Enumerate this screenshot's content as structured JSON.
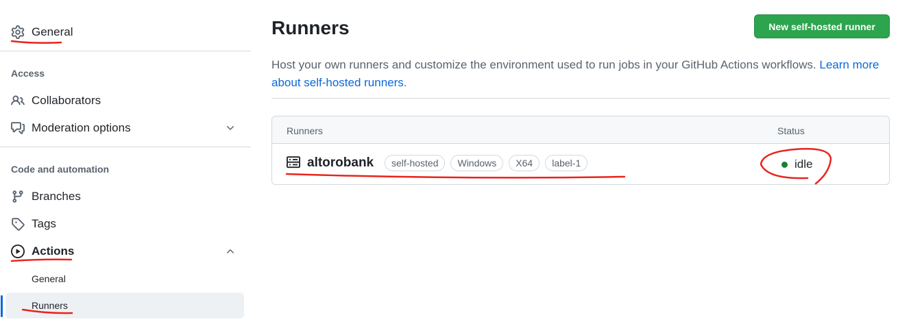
{
  "sidebar": {
    "general": "General",
    "access_title": "Access",
    "collaborators": "Collaborators",
    "moderation": "Moderation options",
    "code_title": "Code and automation",
    "branches": "Branches",
    "tags": "Tags",
    "actions": "Actions",
    "actions_general": "General",
    "actions_runners": "Runners"
  },
  "main": {
    "title": "Runners",
    "new_button": "New self-hosted runner",
    "intro_text": "Host your own runners and customize the environment used to run jobs in your GitHub Actions workflows. ",
    "intro_link": "Learn more about self-hosted runners",
    "intro_end": "."
  },
  "runners_table": {
    "col_runners": "Runners",
    "col_status": "Status",
    "rows": [
      {
        "name": "altorobank",
        "labels": [
          "self-hosted",
          "Windows",
          "X64",
          "label-1"
        ],
        "status": "idle",
        "status_color": "#1a7f37"
      }
    ]
  },
  "colors": {
    "accent": "#0969da",
    "button_green": "#2da44e",
    "annotation_red": "#e8231c"
  },
  "icons": [
    "gear-icon",
    "people-icon",
    "comment-discussion-icon",
    "chevron-down-icon",
    "git-branch-icon",
    "tag-icon",
    "play-icon",
    "chevron-up-icon",
    "server-icon"
  ]
}
